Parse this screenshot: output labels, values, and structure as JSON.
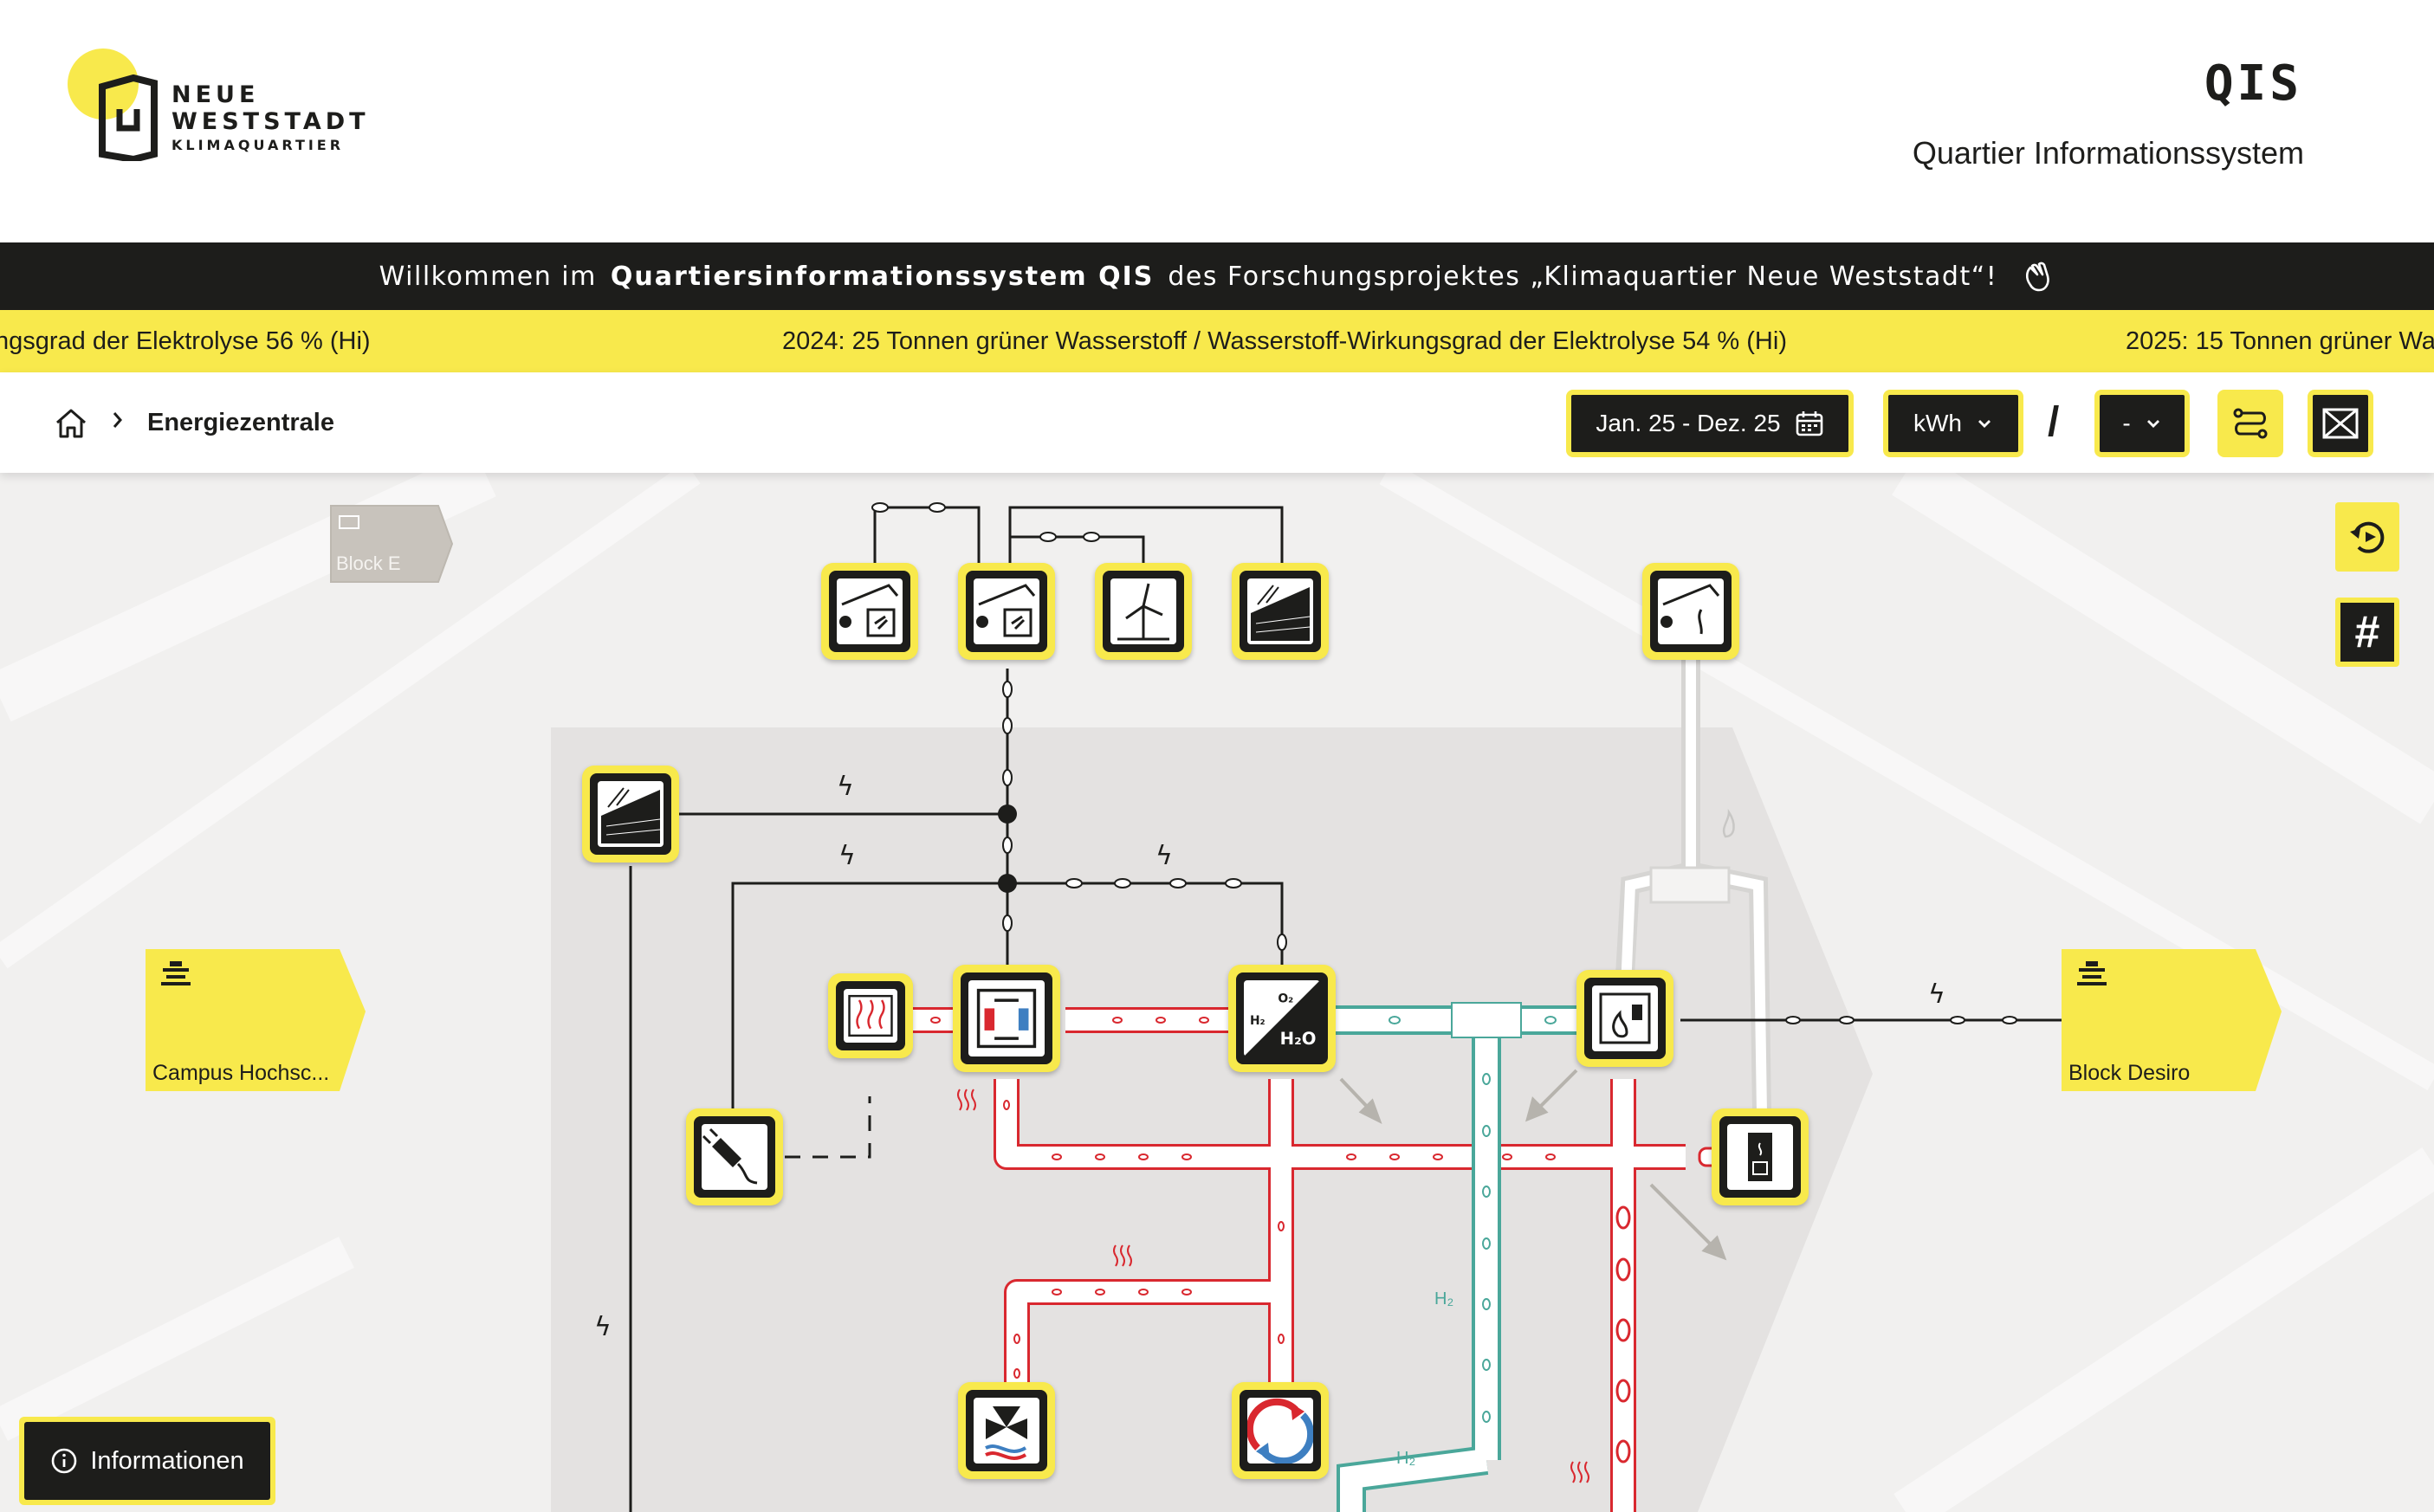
{
  "header": {
    "logo": {
      "line1": "NEUE",
      "line2": "WESTSTADT",
      "line3": "KLIMAQUARTIER"
    },
    "app_title": "QIS",
    "app_subtitle": "Quartier Informationssystem"
  },
  "welcome": {
    "prefix": "Willkommen im",
    "highlight": "Quartiersinformationssystem QIS",
    "suffix": "des Forschungsprojektes „Klimaquartier Neue Weststadt“!"
  },
  "ticker": {
    "items": [
      "ngsgrad der Elektrolyse 56 % (Hi)",
      "2024: 25 Tonnen grüner Wasserstoff / Wasserstoff-Wirkungsgrad der Elektrolyse 54 % (Hi)",
      "2025: 15 Tonnen grüner Wa"
    ]
  },
  "breadcrumb": {
    "current": "Energiezentrale"
  },
  "toolbar": {
    "date_range": "Jan. 25 - Dez. 25",
    "unit": "kWh",
    "separator": "/",
    "secondary_unit": "-"
  },
  "map": {
    "buildings": {
      "block_e": "Block E",
      "campus": "Campus Hochsc...",
      "block_desiro": "Block Desiro"
    },
    "sidebar": {
      "grid_symbol": "#"
    }
  },
  "info_button": {
    "label": "Informationen"
  },
  "colors": {
    "accent_yellow": "#f8e94c",
    "dark": "#1d1d1b",
    "heat_red": "#d9282f",
    "hydrogen_teal": "#4aa79a",
    "gas_grey": "#c8c7c5"
  }
}
